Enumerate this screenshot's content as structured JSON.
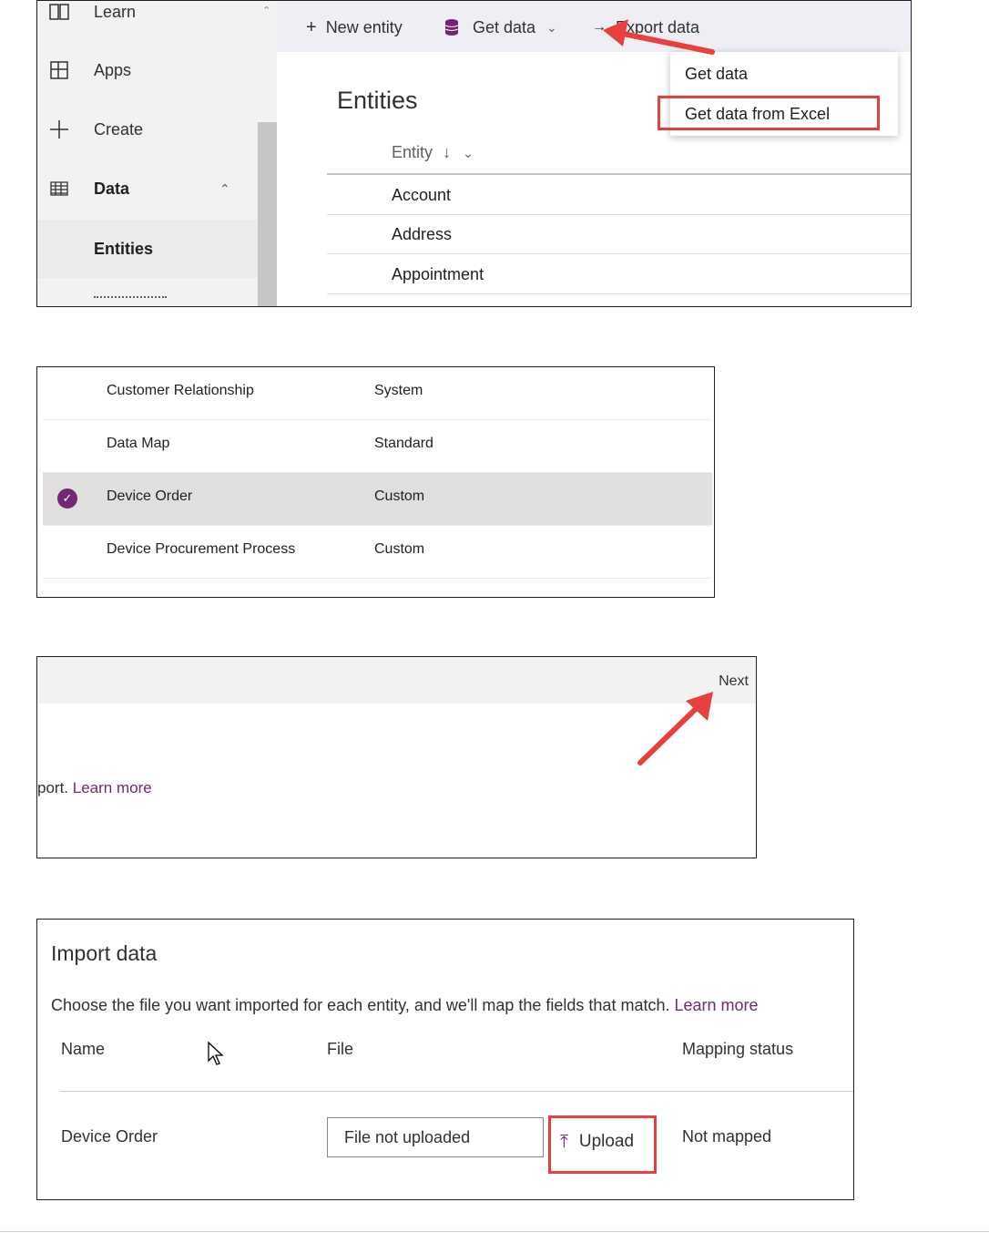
{
  "panel1": {
    "sidebar": {
      "items": [
        {
          "label": "Learn",
          "icon": "book-icon"
        },
        {
          "label": "Apps",
          "icon": "apps-icon"
        },
        {
          "label": "Create",
          "icon": "plus-icon"
        },
        {
          "label": "Data",
          "icon": "table-icon"
        },
        {
          "label": "Entities"
        }
      ]
    },
    "commandbar": {
      "new_entity": "New entity",
      "get_data": "Get data",
      "export_data": "Export data"
    },
    "title": "Entities",
    "column_header": "Entity",
    "rows": [
      "Account",
      "Address",
      "Appointment"
    ],
    "dropdown": {
      "items": [
        "Get data",
        "Get data from Excel"
      ]
    }
  },
  "panel2": {
    "rows": [
      {
        "name": "Customer Relationship",
        "type": "System",
        "selected": false
      },
      {
        "name": "Data Map",
        "type": "Standard",
        "selected": false
      },
      {
        "name": "Device Order",
        "type": "Custom",
        "selected": true
      },
      {
        "name": "Device Procurement Process",
        "type": "Custom",
        "selected": false
      }
    ]
  },
  "panel3": {
    "next_label": "Next",
    "partial_text": "port.",
    "learn_more": "Learn more"
  },
  "panel4": {
    "title": "Import data",
    "description": "Choose the file you want imported for each entity, and we'll map the fields that match.",
    "learn_more": "Learn more",
    "headers": {
      "name": "Name",
      "file": "File",
      "mapping": "Mapping status"
    },
    "row": {
      "name": "Device Order",
      "file_status": "File not uploaded",
      "upload_label": "Upload",
      "mapping_status": "Not mapped"
    }
  },
  "colors": {
    "accent": "#742774",
    "highlight_red": "#e8403e",
    "commandbar_bg": "#f0eef5"
  }
}
